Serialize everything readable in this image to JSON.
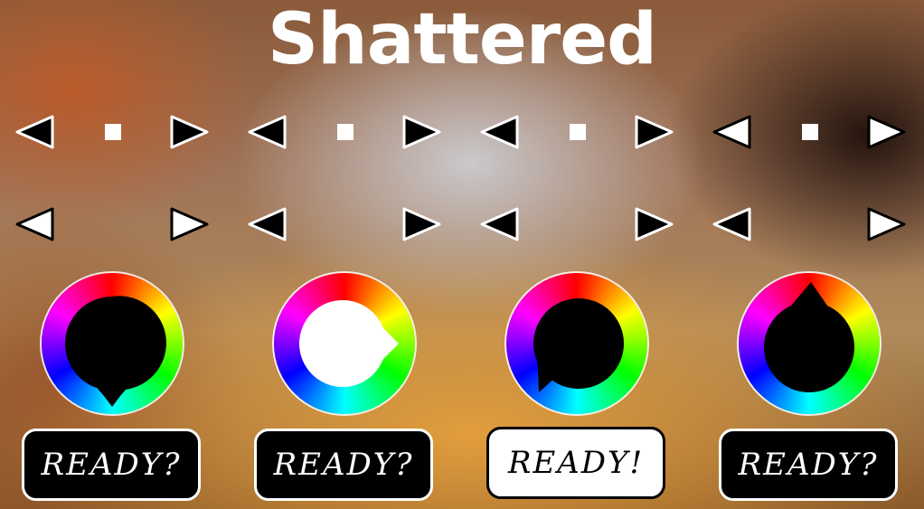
{
  "title": "Shattered",
  "colors": {
    "ready_on_bg": "#ffffff",
    "ready_off_bg": "#000000",
    "arrow_fill": "#000000",
    "arrow_outline": "#ffffff"
  },
  "players": [
    {
      "ready_label": "READY?",
      "is_ready": false,
      "avatar_color": "#000000",
      "avatar_point": "bottom"
    },
    {
      "ready_label": "READY?",
      "is_ready": false,
      "avatar_color": "#ffffff",
      "avatar_point": "right"
    },
    {
      "ready_label": "READY!",
      "is_ready": true,
      "avatar_color": "#000000",
      "avatar_point": "bottom-left"
    },
    {
      "ready_label": "READY?",
      "is_ready": false,
      "avatar_color": "#000000",
      "avatar_point": "top"
    }
  ],
  "icons": {
    "left_arrow": "left-triangle-icon",
    "right_arrow": "right-triangle-icon",
    "selector": "square-indicator-icon",
    "wheel": "color-wheel-icon"
  }
}
